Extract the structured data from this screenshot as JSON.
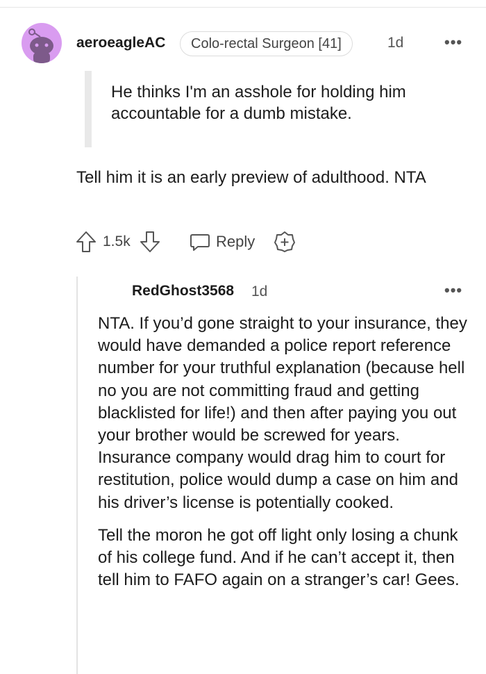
{
  "comment": {
    "author": "aeroeagleAC",
    "flair": "Colo-rectal Surgeon [41]",
    "age": "1d",
    "quote": "He thinks I'm an asshole for holding him accountable for a dumb mistake.",
    "body": "Tell him it is an early preview of adulthood. NTA",
    "score": "1.5k",
    "reply_label": "Reply",
    "more_label": "•••"
  },
  "reply": {
    "author": "RedGhost3568",
    "age": "1d",
    "more_label": "•••",
    "paragraphs": [
      "NTA. If you’d gone straight to your insurance, they would have demanded a police report reference number for your truthful explanation (because hell no you are not committing fraud and getting blacklisted for life!) and then after paying you out your brother would be screwed for years. Insurance company would drag him to court for restitution, police would dump a case on him and his driver’s license is potentially cooked.",
      "Tell the moron he got off light only losing a chunk of his college fund. And if he can’t accept it, then tell him to FAFO again on a stranger’s car! Gees."
    ]
  },
  "colors": {
    "avatar_bg": "#d99cf0",
    "avatar_figure": "#7d5a8a",
    "thread_line": "#e3e3e3",
    "quote_bar": "#e9e9e9"
  }
}
